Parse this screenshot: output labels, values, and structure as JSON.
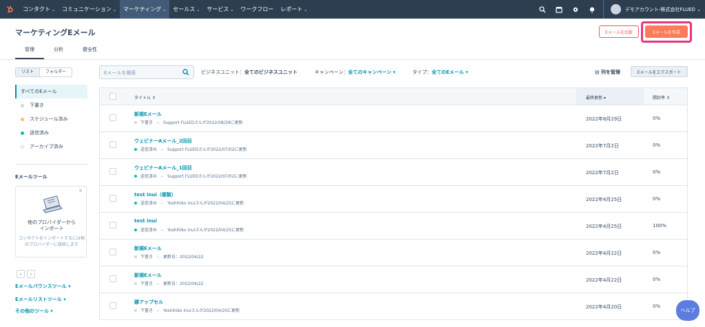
{
  "nav": {
    "logo": "hubspot-logo",
    "items": [
      {
        "label": "コンタクト",
        "caret": "⌄"
      },
      {
        "label": "コミュニケーション",
        "caret": "⌄"
      },
      {
        "label": "マーケティング",
        "caret": "⌄"
      },
      {
        "label": "セールス",
        "caret": "⌄"
      },
      {
        "label": "サービス",
        "caret": "⌄"
      },
      {
        "label": "ワークフロー",
        "caret": ""
      },
      {
        "label": "レポート",
        "caret": "⌄"
      }
    ],
    "active_index": 2,
    "account": "デモアカウント-株式会社FLUED ⌄"
  },
  "header": {
    "title": "マーケティングEメール",
    "tabs": [
      "管理",
      "分析",
      "健全性"
    ],
    "compare_button": "Eメールを比較",
    "create_button": "Eメールを作成"
  },
  "sidebar": {
    "view_toggle": [
      "リスト",
      "フォルダー"
    ],
    "filters": [
      {
        "label": "すべてのEメール",
        "dot": ""
      },
      {
        "label": "下書き",
        "dot": "#cbd6e2"
      },
      {
        "label": "スケジュール済み",
        "dot": "#f5c26b"
      },
      {
        "label": "送信済み",
        "dot": "#00bda5"
      },
      {
        "label": "アーカイブ済み",
        "dot": "hollow"
      }
    ],
    "tools_heading": "Eメールツール",
    "card": {
      "close": "×",
      "title": "他のプロバイダーから\nインポート",
      "desc": "コンタクトをインポートするには他のプロバイダーに接続します"
    },
    "pager": [
      "‹",
      "›"
    ],
    "links": [
      "Eメールバウンスツール ▾",
      "Eメールリストツール ▾",
      "その他のツール ▾"
    ]
  },
  "toolbar": {
    "search_placeholder": "Eメールを検索",
    "business_unit_label": "ビジネスユニット：",
    "business_unit_value": "全てのビジネスユニット",
    "campaign_label": "キャンペーン：",
    "campaign_value": "全てのキャンペーン ▾",
    "type_label": "タイプ：",
    "type_value": "全てのEメール ▾",
    "manage_columns": "列を管理",
    "export": "Eメールをエクスポート"
  },
  "table": {
    "headers": {
      "title": "タイトル ⇕",
      "updated": "最終更新 ▾",
      "open_rate": "開封率 ⇕"
    },
    "rows": [
      {
        "name": "新規Eメール",
        "status": "下書き",
        "dot": "#cbd6e2",
        "sub": "–　Support FLUEDさんが2022/08/29に更新",
        "date": "2022年8月29日",
        "open": "0%"
      },
      {
        "name": "ウェビナーAメール_2回目",
        "status": "送信済み",
        "dot": "#00bda5",
        "sub": "–　Support FLUEDさんが2022/07/02に更新",
        "date": "2022年7月2日",
        "open": "0%"
      },
      {
        "name": "ウェビナーAメール_1回目",
        "status": "送信済み",
        "dot": "#00bda5",
        "sub": "–　Support FLUEDさんが2022/07/02に更新",
        "date": "2022年7月2日",
        "open": "0%"
      },
      {
        "name": "test inui（複製）",
        "status": "送信済み",
        "dot": "#00bda5",
        "sub": "–　Yoshihiko Inuiさんが2022/04/25に更新",
        "date": "2022年4月25日",
        "open": "0%"
      },
      {
        "name": "test inui",
        "status": "送信済み",
        "dot": "#00bda5",
        "sub": "–　Yoshihiko Inuiさんが2022/04/25に更新",
        "date": "2022年4月25日",
        "open": "100%"
      },
      {
        "name": "新規Eメール",
        "status": "下書き",
        "dot": "#cbd6e2",
        "sub": "–　更新日：2022/04/22",
        "date": "2022年4月22日",
        "open": "0%"
      },
      {
        "name": "新規Eメール",
        "status": "下書き",
        "dot": "#cbd6e2",
        "sub": "–　更新日：2022/04/22",
        "date": "2022年4月22日",
        "open": "0%"
      },
      {
        "name": "娜アップセル",
        "status": "下書き",
        "dot": "#cbd6e2",
        "sub": "–　Yoshihiko Inuiさんが2022/04/20に更新",
        "date": "2022年4月20日",
        "open": "0%"
      }
    ]
  },
  "help": "ヘルプ"
}
